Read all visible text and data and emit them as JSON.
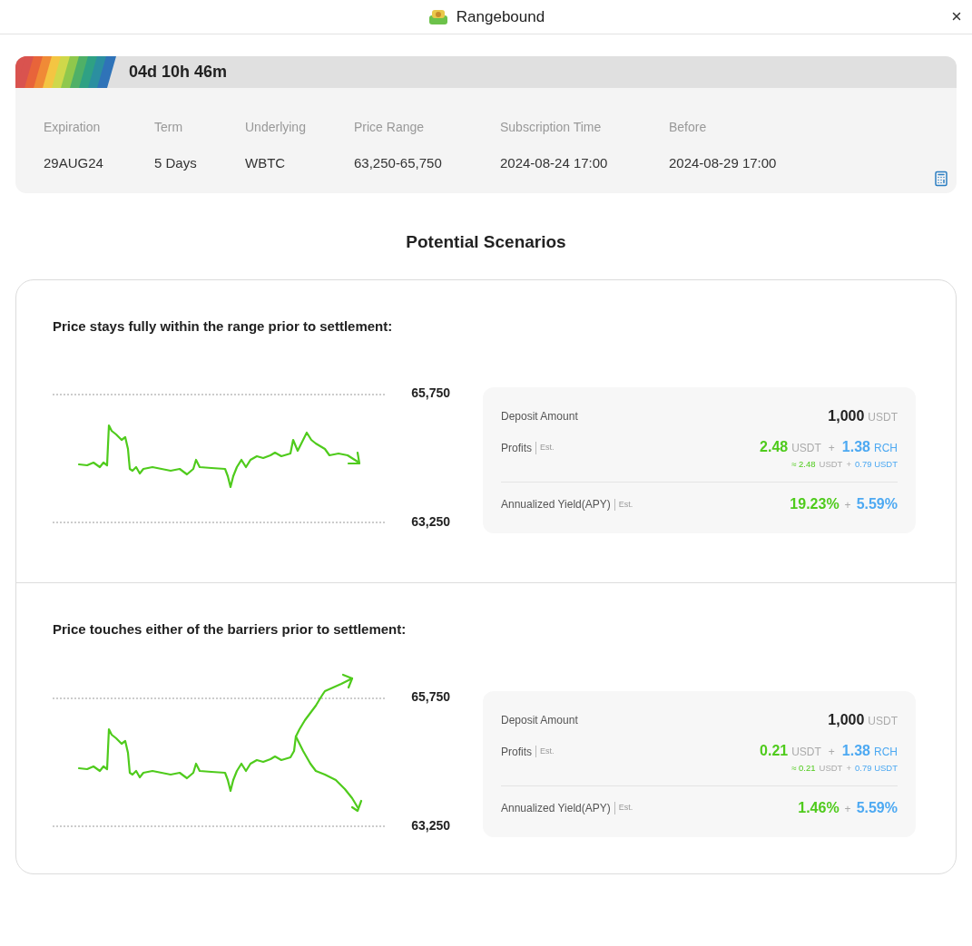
{
  "window": {
    "title": "Rangebound"
  },
  "countdown": "04d 10h 46m",
  "details": [
    {
      "label": "Expiration",
      "value": "29AUG24"
    },
    {
      "label": "Term",
      "value": "5 Days"
    },
    {
      "label": "Underlying",
      "value": "WBTC"
    },
    {
      "label": "Price Range",
      "value": "63,250-65,750"
    },
    {
      "label": "Subscription Time",
      "value": "2024-08-24 17:00"
    },
    {
      "label": "Before",
      "value": "2024-08-29 17:00"
    }
  ],
  "section_title": "Potential Scenarios",
  "scenarios": [
    {
      "title": "Price stays fully within the range prior to settlement:",
      "kind": "within",
      "upper": "65,750",
      "lower": "63,250",
      "deposit": {
        "label": "Deposit Amount",
        "amount": "1,000",
        "unit": "USDT"
      },
      "profits": {
        "label": "Profits",
        "tag": "Est.",
        "usdt": "2.48",
        "usdt_unit": "USDT",
        "plus": "+",
        "rch": "1.38",
        "rch_unit": "RCH",
        "approx": "≈ 2.48",
        "approx_unit": "USDT",
        "approx_plus": "+",
        "approx_rch": "0.79 USDT"
      },
      "apy": {
        "label": "Annualized Yield(APY)",
        "tag": "Est.",
        "base": "19.23%",
        "plus": "+",
        "bonus": "5.59%"
      }
    },
    {
      "title": "Price touches either of the barriers prior to settlement:",
      "kind": "breakout",
      "upper": "65,750",
      "lower": "63,250",
      "deposit": {
        "label": "Deposit Amount",
        "amount": "1,000",
        "unit": "USDT"
      },
      "profits": {
        "label": "Profits",
        "tag": "Est.",
        "usdt": "0.21",
        "usdt_unit": "USDT",
        "plus": "+",
        "rch": "1.38",
        "rch_unit": "RCH",
        "approx": "≈ 0.21",
        "approx_unit": "USDT",
        "approx_plus": "+",
        "approx_rch": "0.79 USDT"
      },
      "apy": {
        "label": "Annualized Yield(APY)",
        "tag": "Est.",
        "base": "1.46%",
        "plus": "+",
        "bonus": "5.59%"
      }
    }
  ]
}
